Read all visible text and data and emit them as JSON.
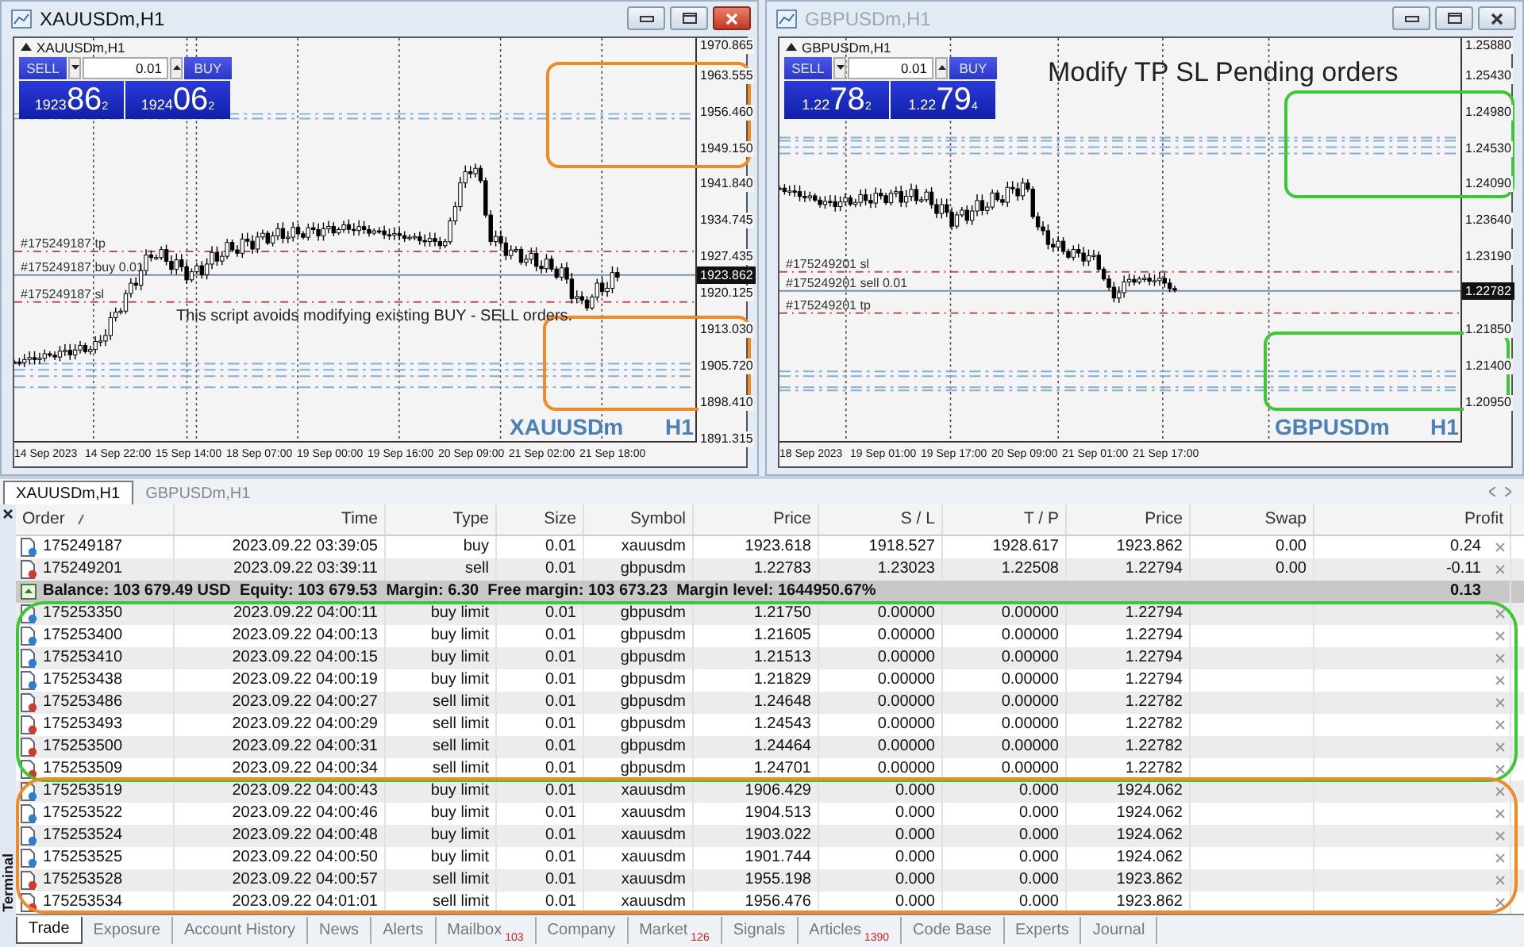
{
  "charts": [
    {
      "title": "XAUUSDm,H1",
      "active": true,
      "inner_label": "XAUUSDm,H1",
      "trade_panel": {
        "sell": "SELL",
        "lot": "0.01",
        "buy": "BUY",
        "bid": {
          "head": "1923",
          "big": "86",
          "tail": "2"
        },
        "ask": {
          "head": "1924",
          "big": "06",
          "tail": "2"
        }
      },
      "price_ticks": [
        "1970.865",
        "1963.555",
        "1956.460",
        "1949.150",
        "1941.840",
        "1934.745",
        "1927.435",
        "1920.125",
        "1913.030",
        "1905.720",
        "1898.410",
        "1891.315"
      ],
      "current_price": "1923.862",
      "time_labels": [
        "14 Sep 2023",
        "14 Sep 22:00",
        "15 Sep 14:00",
        "18 Sep 07:00",
        "19 Sep 00:00",
        "19 Sep 16:00",
        "20 Sep 09:00",
        "21 Sep 02:00",
        "21 Sep 18:00"
      ],
      "order_lines": [
        {
          "label": "#175249187 tp",
          "kind": "tp"
        },
        {
          "label": "#175249187 buy 0.01",
          "kind": "entry"
        },
        {
          "label": "#175249187 sl",
          "kind": "sl"
        }
      ],
      "caption": {
        "kind": "note",
        "text": "This script avoids modifying existing BUY - SELL orders."
      },
      "symbol_mark": "XAUUSDm",
      "period_mark": "H1"
    },
    {
      "title": "GBPUSDm,H1",
      "active": false,
      "inner_label": "GBPUSDm,H1",
      "trade_panel": {
        "sell": "SELL",
        "lot": "0.01",
        "buy": "BUY",
        "bid": {
          "head": "1.22",
          "big": "78",
          "tail": "2"
        },
        "ask": {
          "head": "1.22",
          "big": "79",
          "tail": "4"
        }
      },
      "price_ticks": [
        "1.25880",
        "1.25430",
        "1.24980",
        "1.24530",
        "1.24090",
        "1.23640",
        "1.23190",
        "1.21850",
        "1.21400",
        "1.20950"
      ],
      "current_price": "1.22782",
      "time_labels": [
        "18 Sep 2023",
        "19 Sep 01:00",
        "19 Sep 17:00",
        "20 Sep 09:00",
        "21 Sep 01:00",
        "21 Sep 17:00"
      ],
      "order_lines": [
        {
          "label": "#175249201 sl",
          "kind": "sl"
        },
        {
          "label": "#175249201 sell 0.01",
          "kind": "entry"
        },
        {
          "label": "#175249201 tp",
          "kind": "tp"
        }
      ],
      "caption": {
        "kind": "headline",
        "text": "Modify TP SL Pending orders"
      },
      "symbol_mark": "GBPUSDm",
      "period_mark": "H1"
    }
  ],
  "chart_tabs": [
    {
      "label": "XAUUSDm,H1",
      "selected": true
    },
    {
      "label": "GBPUSDm,H1",
      "selected": false
    }
  ],
  "terminal_label": "Terminal",
  "table": {
    "columns": [
      "Order",
      "Time",
      "Type",
      "Size",
      "Symbol",
      "Price",
      "S / L",
      "T / P",
      "Price",
      "Swap",
      "Profit"
    ],
    "rows": [
      {
        "kind": "buy",
        "cells": [
          "175249187",
          "2023.09.22 03:39:05",
          "buy",
          "0.01",
          "xauusdm",
          "1923.618",
          "1918.527",
          "1928.617",
          "1923.862",
          "0.00",
          "0.24"
        ]
      },
      {
        "kind": "sell",
        "cells": [
          "175249201",
          "2023.09.22 03:39:11",
          "sell",
          "0.01",
          "gbpusdm",
          "1.22783",
          "1.23023",
          "1.22508",
          "1.22794",
          "0.00",
          "-0.11"
        ]
      },
      {
        "kind": "balance",
        "text": "Balance: 103 679.49 USD  Equity: 103 679.53  Margin: 6.30  Free margin: 103 673.23  Margin level: 1644950.67%",
        "profit": "0.13"
      },
      {
        "kind": "buy",
        "cells": [
          "175253350",
          "2023.09.22 04:00:11",
          "buy limit",
          "0.01",
          "gbpusdm",
          "1.21750",
          "0.00000",
          "0.00000",
          "1.22794"
        ]
      },
      {
        "kind": "buy",
        "cells": [
          "175253400",
          "2023.09.22 04:00:13",
          "buy limit",
          "0.01",
          "gbpusdm",
          "1.21605",
          "0.00000",
          "0.00000",
          "1.22794"
        ]
      },
      {
        "kind": "buy",
        "cells": [
          "175253410",
          "2023.09.22 04:00:15",
          "buy limit",
          "0.01",
          "gbpusdm",
          "1.21513",
          "0.00000",
          "0.00000",
          "1.22794"
        ]
      },
      {
        "kind": "buy",
        "cells": [
          "175253438",
          "2023.09.22 04:00:19",
          "buy limit",
          "0.01",
          "gbpusdm",
          "1.21829",
          "0.00000",
          "0.00000",
          "1.22794"
        ]
      },
      {
        "kind": "sell",
        "cells": [
          "175253486",
          "2023.09.22 04:00:27",
          "sell limit",
          "0.01",
          "gbpusdm",
          "1.24648",
          "0.00000",
          "0.00000",
          "1.22782"
        ]
      },
      {
        "kind": "sell",
        "cells": [
          "175253493",
          "2023.09.22 04:00:29",
          "sell limit",
          "0.01",
          "gbpusdm",
          "1.24543",
          "0.00000",
          "0.00000",
          "1.22782"
        ]
      },
      {
        "kind": "sell",
        "cells": [
          "175253500",
          "2023.09.22 04:00:31",
          "sell limit",
          "0.01",
          "gbpusdm",
          "1.24464",
          "0.00000",
          "0.00000",
          "1.22782"
        ]
      },
      {
        "kind": "sell",
        "cells": [
          "175253509",
          "2023.09.22 04:00:34",
          "sell limit",
          "0.01",
          "gbpusdm",
          "1.24701",
          "0.00000",
          "0.00000",
          "1.22782"
        ]
      },
      {
        "kind": "buy",
        "cells": [
          "175253519",
          "2023.09.22 04:00:43",
          "buy limit",
          "0.01",
          "xauusdm",
          "1906.429",
          "0.000",
          "0.000",
          "1924.062"
        ]
      },
      {
        "kind": "buy",
        "cells": [
          "175253522",
          "2023.09.22 04:00:46",
          "buy limit",
          "0.01",
          "xauusdm",
          "1904.513",
          "0.000",
          "0.000",
          "1924.062"
        ]
      },
      {
        "kind": "buy",
        "cells": [
          "175253524",
          "2023.09.22 04:00:48",
          "buy limit",
          "0.01",
          "xauusdm",
          "1903.022",
          "0.000",
          "0.000",
          "1924.062"
        ]
      },
      {
        "kind": "buy",
        "cells": [
          "175253525",
          "2023.09.22 04:00:50",
          "buy limit",
          "0.01",
          "xauusdm",
          "1901.744",
          "0.000",
          "0.000",
          "1924.062"
        ]
      },
      {
        "kind": "sell",
        "cells": [
          "175253528",
          "2023.09.22 04:00:57",
          "sell limit",
          "0.01",
          "xauusdm",
          "1955.198",
          "0.000",
          "0.000",
          "1923.862"
        ]
      },
      {
        "kind": "sell",
        "cells": [
          "175253534",
          "2023.09.22 04:01:01",
          "sell limit",
          "0.01",
          "xauusdm",
          "1956.476",
          "0.000",
          "0.000",
          "1923.862"
        ]
      }
    ]
  },
  "bottom_tabs": [
    {
      "label": "Trade",
      "selected": true
    },
    {
      "label": "Exposure",
      "selected": false
    },
    {
      "label": "Account History",
      "selected": false
    },
    {
      "label": "News",
      "selected": false
    },
    {
      "label": "Alerts",
      "selected": false
    },
    {
      "label": "Mailbox",
      "badge": "103",
      "selected": false
    },
    {
      "label": "Company",
      "selected": false
    },
    {
      "label": "Market",
      "badge": "126",
      "selected": false
    },
    {
      "label": "Signals",
      "selected": false
    },
    {
      "label": "Articles",
      "badge": "1390",
      "selected": false
    },
    {
      "label": "Code Base",
      "selected": false
    },
    {
      "label": "Experts",
      "selected": false
    },
    {
      "label": "Journal",
      "selected": false
    }
  ]
}
